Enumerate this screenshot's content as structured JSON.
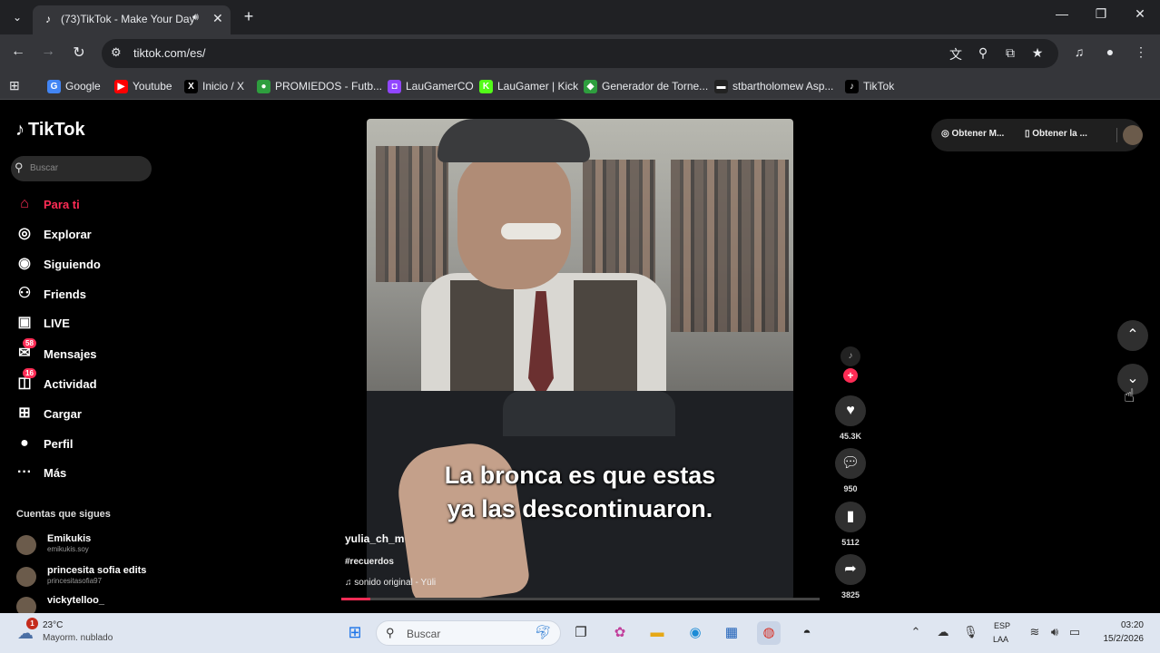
{
  "browser": {
    "tab_title": "(73)TikTok - Make Your Day",
    "url": "tiktok.com/es/",
    "bookmarks": [
      {
        "label": "Google",
        "icon": "G",
        "color": "#4285f4"
      },
      {
        "label": "Youtube",
        "icon": "▶",
        "color": "#ff0000"
      },
      {
        "label": "Inicio / X",
        "icon": "X",
        "color": "#000000"
      },
      {
        "label": "PROMIEDOS - Futb...",
        "icon": "●",
        "color": "#2e9e3e"
      },
      {
        "label": "LauGamerCO",
        "icon": "◘",
        "color": "#9146ff"
      },
      {
        "label": "LauGamer | Kick",
        "icon": "K",
        "color": "#53fc18"
      },
      {
        "label": "Generador de Torne...",
        "icon": "◆",
        "color": "#2e9e3e"
      },
      {
        "label": "stbartholomew Asp...",
        "icon": "▬",
        "color": "#222222"
      },
      {
        "label": "TikTok",
        "icon": "♪",
        "color": "#000000"
      }
    ]
  },
  "tiktok": {
    "logo": "TikTok",
    "search_placeholder": "Buscar",
    "nav": [
      {
        "label": "Para ti",
        "icon": "home-icon",
        "glyph": "⌂",
        "badge": ""
      },
      {
        "label": "Explorar",
        "icon": "compass-icon",
        "glyph": "◎",
        "badge": ""
      },
      {
        "label": "Siguiendo",
        "icon": "following-icon",
        "glyph": "◉",
        "badge": ""
      },
      {
        "label": "Friends",
        "icon": "friends-icon",
        "glyph": "⚇",
        "badge": ""
      },
      {
        "label": "LIVE",
        "icon": "live-icon",
        "glyph": "▣",
        "badge": ""
      },
      {
        "label": "Mensajes",
        "icon": "messages-icon",
        "glyph": "✉",
        "badge": "58"
      },
      {
        "label": "Actividad",
        "icon": "activity-icon",
        "glyph": "◫",
        "badge": "16"
      },
      {
        "label": "Cargar",
        "icon": "upload-icon",
        "glyph": "⊞",
        "badge": ""
      },
      {
        "label": "Perfil",
        "icon": "profile-icon",
        "glyph": "●",
        "badge": ""
      },
      {
        "label": "Más",
        "icon": "more-icon",
        "glyph": "···",
        "badge": ""
      }
    ],
    "following_header": "Cuentas que sigues",
    "following": [
      {
        "name": "Emikukis",
        "handle": "emikukis.soy"
      },
      {
        "name": "princesita sofia edits",
        "handle": "princesitasofia97"
      },
      {
        "name": "vickytelloo_",
        "handle": ""
      }
    ],
    "top_right": {
      "get_app": "Obtener M...",
      "get_desktop": "Obtener la ..."
    },
    "video": {
      "caption_line1": "La bronca es que estas",
      "caption_line2": "ya las descontinuaron.",
      "username": "yulia_ch_m",
      "hashtag": "#recuerdos",
      "sound": "sonido original - Yüli",
      "progress": 0.06
    },
    "actions": {
      "likes": "45.3K",
      "comments": "950",
      "saves": "5112",
      "shares": "3825"
    }
  },
  "taskbar": {
    "temperature": "23°C",
    "weather": "Mayorm. nublado",
    "weather_badge": "1",
    "search_placeholder": "Buscar",
    "lang_top": "ESP",
    "lang_bottom": "LAA",
    "time": "03:20",
    "date": "15/2/2026"
  }
}
